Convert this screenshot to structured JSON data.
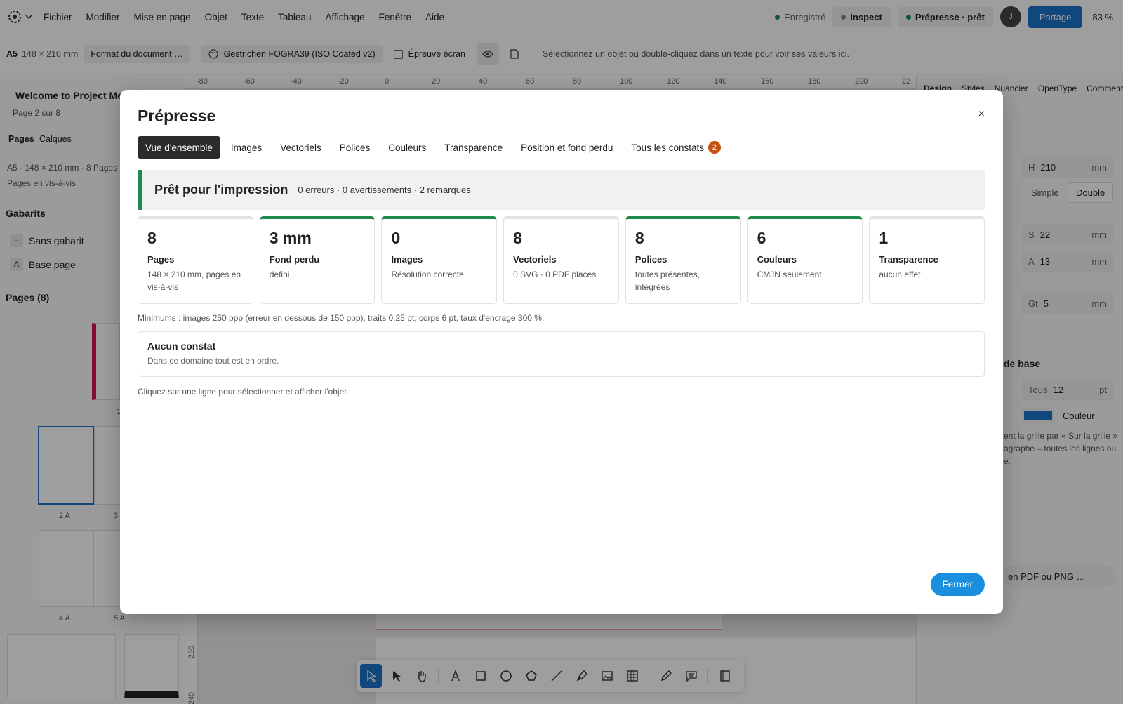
{
  "menubar": {
    "items": [
      "Fichier",
      "Modifier",
      "Mise en page",
      "Objet",
      "Texte",
      "Tableau",
      "Affichage",
      "Fenêtre",
      "Aide"
    ],
    "status_saved": "Enregistré",
    "inspect_label": "Inspect",
    "prepress_label": "Prépresse · prêt",
    "avatar_initial": "J",
    "share_label": "Partage",
    "zoom": "83 %"
  },
  "secondary_bar": {
    "format_code": "A5",
    "format_size": "148 × 210 mm",
    "format_button": "Format du document …",
    "color_profile": "Gestrichen FOGRA39 (ISO Coated v2)",
    "soft_proof_label": "Épreuve écran",
    "hint": "Sélectionnez un objet ou double-cliquez dans un texte pour voir ses valeurs ici."
  },
  "left_panel": {
    "doc_title": "Welcome to Project Me",
    "page_info": "Page 2 sur 8",
    "tabs": [
      "Pages",
      "Calques"
    ],
    "meta_line1": "A5 · 148 × 210 mm · 8 Pages ·",
    "meta_line2": "Pages en vis-à-vis",
    "templates_heading": "Gabarits",
    "templates": [
      {
        "letter": "–",
        "name": "Sans gabarit"
      },
      {
        "letter": "A",
        "name": "Base page"
      }
    ],
    "pages_heading": "Pages (8)",
    "page_labels": [
      "1",
      "2 A",
      "3",
      "4 A",
      "5 A"
    ]
  },
  "right_panel": {
    "tabs": [
      "Design",
      "Styles",
      "Nuancier",
      "OpenType",
      "Commentai"
    ],
    "h_label": "H",
    "h_value": "210",
    "h_unit": "mm",
    "simple_label": "Simple",
    "double_label": "Double",
    "s_label": "S",
    "s_value": "22",
    "s_unit": "mm",
    "a_label": "A",
    "a_value": "13",
    "a_unit": "mm",
    "gt_label": "Gt",
    "gt_value": "5",
    "gt_unit": "mm",
    "section_title": "de base",
    "tous_label": "Tous",
    "tous_value": "12",
    "tous_unit": "pt",
    "color_label": "Couleur",
    "grid_text": "ent la grille par « Sur la grille » agraphe – toutes les lignes ou e.",
    "export_label": "en PDF ou PNG …"
  },
  "modal": {
    "title": "Prépresse",
    "close_glyph": "×",
    "tabs": [
      {
        "label": "Vue d'ensemble",
        "active": true
      },
      {
        "label": "Images"
      },
      {
        "label": "Vectoriels"
      },
      {
        "label": "Polices"
      },
      {
        "label": "Couleurs"
      },
      {
        "label": "Transparence"
      },
      {
        "label": "Position et fond perdu"
      },
      {
        "label": "Tous les constats",
        "badge": "2"
      }
    ],
    "status_title": "Prêt pour l'impression",
    "status_summary": "0 erreurs · 0 avertissements · 2 remarques",
    "cards": [
      {
        "value": "8",
        "label": "Pages",
        "desc": "148 × 210 mm, pages en vis-à-vis",
        "ok": false
      },
      {
        "value": "3 mm",
        "label": "Fond perdu",
        "desc": "défini",
        "ok": true
      },
      {
        "value": "0",
        "label": "Images",
        "desc": "Résolution correcte",
        "ok": true
      },
      {
        "value": "8",
        "label": "Vectoriels",
        "desc": "0 SVG · 0 PDF placés",
        "ok": false
      },
      {
        "value": "8",
        "label": "Polices",
        "desc": "toutes présentes, intégrées",
        "ok": true
      },
      {
        "value": "6",
        "label": "Couleurs",
        "desc": "CMJN seulement",
        "ok": true
      },
      {
        "value": "1",
        "label": "Transparence",
        "desc": "aucun effet",
        "ok": false
      }
    ],
    "minimums": "Minimums : images 250 ppp (erreur en dessous de 150 ppp), traits 0.25 pt, corps 6 pt, taux d'encrage 300 %.",
    "no_findings_title": "Aucun constat",
    "no_findings_desc": "Dans ce domaine tout est en ordre.",
    "hint": "Cliquez sur une ligne pour sélectionner et afficher l'objet.",
    "close_button": "Fermer"
  },
  "ruler": {
    "ticks": [
      "-80",
      "-60",
      "-40",
      "-20",
      "0",
      "20",
      "40",
      "60",
      "80",
      "100",
      "120",
      "140",
      "160",
      "180",
      "200",
      "22"
    ]
  },
  "vertical_ruler": {
    "ticks": [
      "220",
      "240"
    ]
  },
  "colors": {
    "accent": "#1a73c9",
    "ok_green": "#1e8a4c",
    "badge_orange": "#c4520f"
  },
  "tools": [
    "select-icon",
    "direct-select-icon",
    "hand-icon",
    "text-icon",
    "rectangle-icon",
    "ellipse-icon",
    "polygon-icon",
    "line-icon",
    "pen-icon",
    "image-icon",
    "table-icon",
    "pencil-icon",
    "comment-icon",
    "frame-icon"
  ]
}
